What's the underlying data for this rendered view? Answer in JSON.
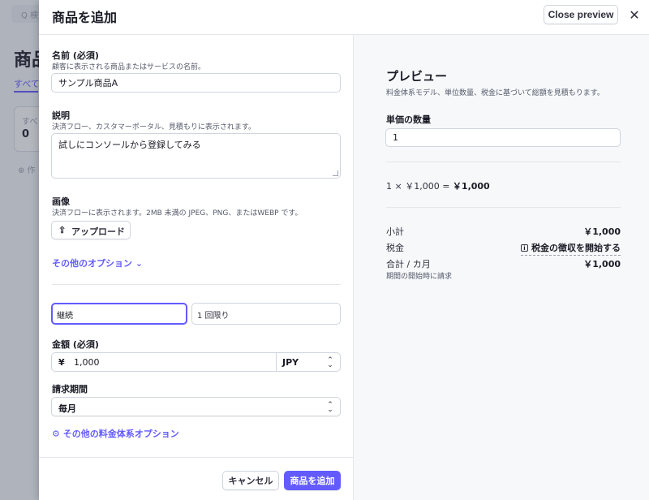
{
  "background": {
    "search_icon": "search-icon",
    "search_placeholder": "Q 検",
    "title": "商品",
    "tab": "すべて",
    "card_label": "すべ",
    "card_count": "0",
    "create_link": "⊕ 作"
  },
  "header": {
    "title": "商品を追加",
    "close_preview_label": "Close preview",
    "close_icon": "close-icon"
  },
  "form": {
    "name_label": "名前 (必須)",
    "name_hint": "顧客に表示される商品またはサービスの名前。",
    "name_value": "サンプル商品A",
    "description_label": "説明",
    "description_hint": "決済フロー、カスタマーポータル、見積もりに表示されます。",
    "description_value": "試しにコンソールから登録してみる",
    "image_label": "画像",
    "image_hint": "決済フローに表示されます。2MB 未満の JPEG、PNG、またはWEBP です。",
    "upload_icon": "upload-icon",
    "upload_label": "アップロード",
    "more_options_label": "その他のオプション",
    "more_options_icon": "chevron-down-icon",
    "billing_type_options": [
      "継続",
      "1 回限り"
    ],
    "billing_type_selected": "継続",
    "amount_label": "金額 (必須)",
    "currency_symbol": "¥",
    "amount_value": "1,000",
    "currency": "JPY",
    "period_label": "請求期間",
    "period_value": "毎月",
    "more_price_options_icon": "gear-icon",
    "more_price_options_label": "その他の料金体系オプション",
    "cancel_label": "キャンセル",
    "submit_label": "商品を追加"
  },
  "preview": {
    "title": "プレビュー",
    "subtitle": "料金体系モデル、単位数量、税金に基づいて総額を見積もります。",
    "quantity_label": "単価の数量",
    "quantity_value": "1",
    "formula_prefix": "1 × ￥1,000 =",
    "formula_result": "￥1,000",
    "subtotal_label": "小計",
    "subtotal_value": "￥1,000",
    "tax_label": "税金",
    "tax_icon": "info-icon",
    "tax_link": "税金の徴収を開始する",
    "total_label": "合計 / カ月",
    "total_value": "￥1,000",
    "total_note": "期間の開始時に請求"
  },
  "colors": {
    "accent": "#635bff",
    "preview_bg": "#f6f8fa",
    "border": "#d0d5dd"
  }
}
